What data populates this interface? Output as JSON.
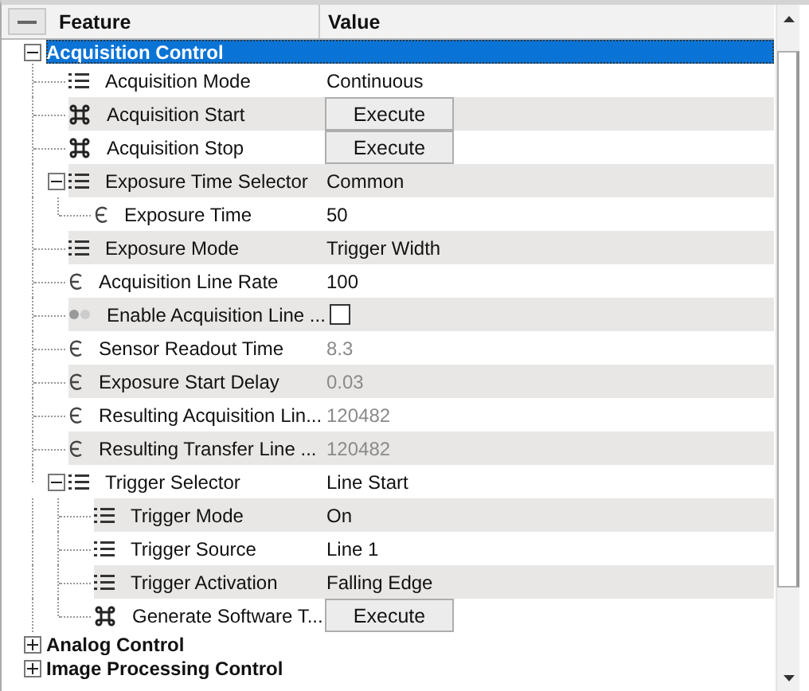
{
  "header": {
    "columns": [
      "Feature",
      "Value"
    ]
  },
  "categories": [
    {
      "name": "Acquisition Control",
      "expanded": true,
      "selected": true,
      "features": [
        {
          "name": "Acquisition Mode",
          "kind": "enum",
          "value": "Continuous",
          "disabled": false
        },
        {
          "name": "Acquisition Start",
          "kind": "command",
          "button": "Execute"
        },
        {
          "name": "Acquisition Stop",
          "kind": "command",
          "button": "Execute"
        },
        {
          "name": "Exposure Time Selector",
          "kind": "enum",
          "value": "Common",
          "disabled": false,
          "expanded": true,
          "children": [
            {
              "name": "Exposure Time",
              "kind": "float",
              "value": "50",
              "disabled": false
            }
          ]
        },
        {
          "name": "Exposure Mode",
          "kind": "enum",
          "value": "Trigger Width",
          "disabled": false
        },
        {
          "name": "Acquisition Line Rate",
          "kind": "float",
          "value": "100",
          "disabled": false
        },
        {
          "name": "Enable Acquisition Line ...",
          "kind": "boolean",
          "checked": false
        },
        {
          "name": "Sensor Readout Time",
          "kind": "float",
          "value": "8.3",
          "disabled": true
        },
        {
          "name": "Exposure Start Delay",
          "kind": "float",
          "value": "0.03",
          "disabled": true
        },
        {
          "name": "Resulting Acquisition Lin...",
          "kind": "float",
          "value": "120482",
          "disabled": true
        },
        {
          "name": "Resulting Transfer Line ...",
          "kind": "float",
          "value": "120482",
          "disabled": true
        },
        {
          "name": "Trigger Selector",
          "kind": "enum",
          "value": "Line Start",
          "disabled": false,
          "expanded": true,
          "children": [
            {
              "name": "Trigger Mode",
              "kind": "enum",
              "value": "On",
              "disabled": false
            },
            {
              "name": "Trigger Source",
              "kind": "enum",
              "value": "Line 1",
              "disabled": false
            },
            {
              "name": "Trigger Activation",
              "kind": "enum",
              "value": "Falling Edge",
              "disabled": false
            },
            {
              "name": "Generate Software T...",
              "kind": "command",
              "button": "Execute"
            }
          ]
        }
      ]
    },
    {
      "name": "Analog Control",
      "expanded": false,
      "selected": false
    },
    {
      "name": "Image Processing Control",
      "expanded": false,
      "selected": false
    }
  ]
}
